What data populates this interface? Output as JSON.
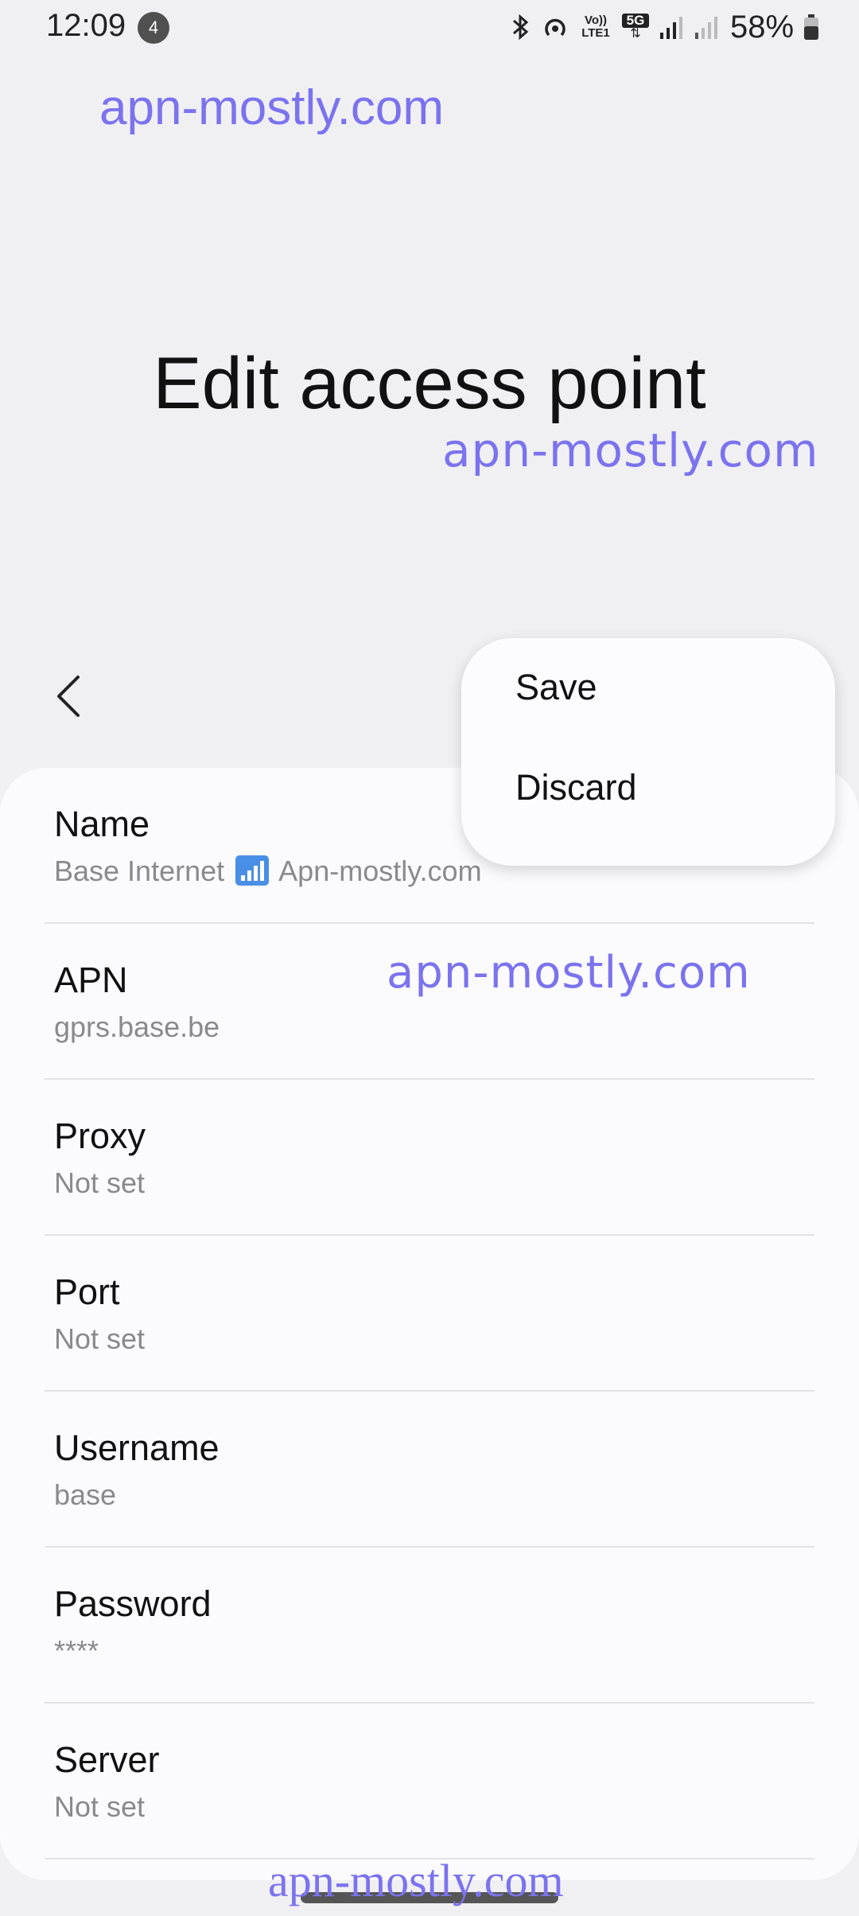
{
  "status_bar": {
    "time": "12:09",
    "notification_count": "4",
    "volte_label": "Vo)) LTE1",
    "network_label": "5G",
    "battery": "58%",
    "icons": [
      "bluetooth-icon",
      "hotspot-icon",
      "volte-icon",
      "5g-icon",
      "signal-sim1-icon",
      "signal-sim2-icon",
      "battery-icon"
    ]
  },
  "watermarks": [
    "apn-mostly.com",
    "apn-mostly.com",
    "apn-mostly.com",
    "apn-mostly.com"
  ],
  "header": {
    "title": "Edit access point",
    "back_icon": "chevron-left-icon"
  },
  "menu": {
    "items": [
      "Save",
      "Discard"
    ]
  },
  "fields": [
    {
      "label": "Name",
      "value_prefix": "Base Internet",
      "value_icon": "signal-bars-icon",
      "value_suffix": "Apn-mostly.com"
    },
    {
      "label": "APN",
      "value": "gprs.base.be"
    },
    {
      "label": "Proxy",
      "value": "Not set"
    },
    {
      "label": "Port",
      "value": "Not set"
    },
    {
      "label": "Username",
      "value": "base"
    },
    {
      "label": "Password",
      "value": "****"
    },
    {
      "label": "Server",
      "value": "Not set"
    }
  ],
  "colors": {
    "background": "#f0f0f3",
    "card": "#fbfbfd",
    "watermark": "#7b73ee",
    "secondary_text": "#8a8a8e"
  }
}
